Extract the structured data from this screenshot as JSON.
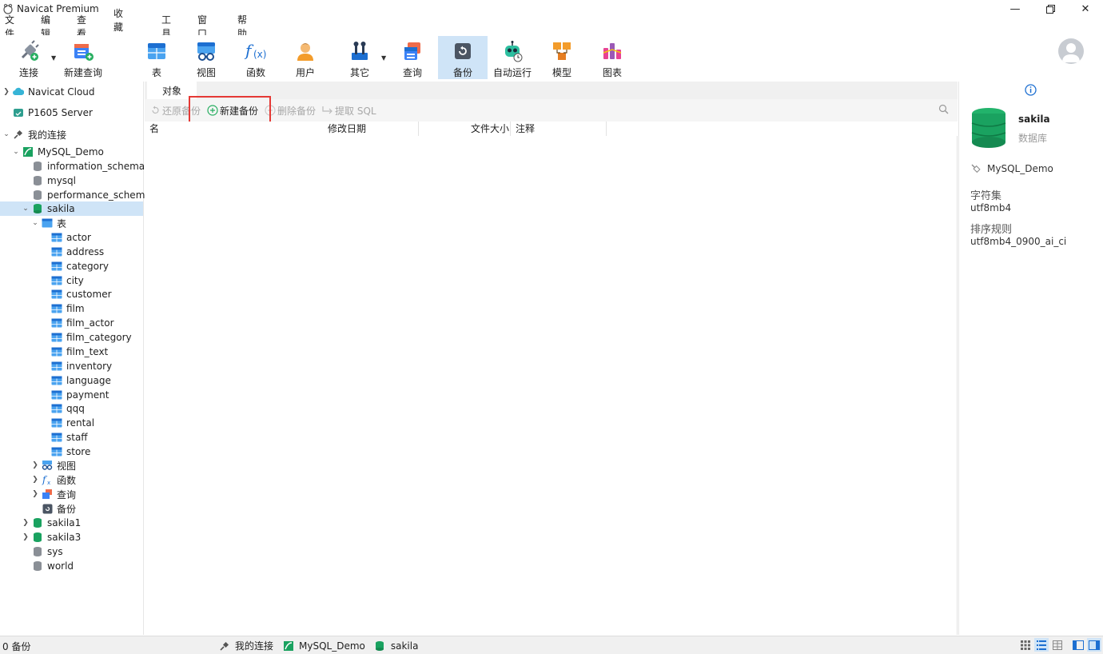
{
  "window": {
    "title": "Navicat Premium"
  },
  "menu": [
    "文件",
    "编辑",
    "查看",
    "收藏夹",
    "工具",
    "窗口",
    "帮助"
  ],
  "toolbar": {
    "connect": "连接",
    "new_query": "新建查询",
    "table": "表",
    "view": "视图",
    "function": "函数",
    "user": "用户",
    "other": "其它",
    "query": "查询",
    "backup": "备份",
    "automation": "自动运行",
    "model": "模型",
    "chart": "图表"
  },
  "nav": {
    "navicat_cloud": "Navicat Cloud",
    "p1605_server": "P1605 Server",
    "my_connections": "我的连接",
    "mysql_demo": "MySQL_Demo",
    "databases_top": [
      "information_schema",
      "mysql",
      "performance_schema"
    ],
    "sakila": "sakila",
    "tables_group": "表",
    "tables": [
      "actor",
      "address",
      "category",
      "city",
      "customer",
      "film",
      "film_actor",
      "film_category",
      "film_text",
      "inventory",
      "language",
      "payment",
      "qqq",
      "rental",
      "staff",
      "store"
    ],
    "views": "视图",
    "functions": "函数",
    "queries": "查询",
    "backups": "备份",
    "databases_bottom": [
      "sakila1",
      "sakila3",
      "sys",
      "world"
    ]
  },
  "main": {
    "tab": "对象",
    "restore_backup": "还原备份",
    "new_backup": "新建备份",
    "delete_backup": "删除备份",
    "extract_sql": "提取 SQL",
    "columns": {
      "name": "名",
      "modified": "修改日期",
      "size": "文件大小",
      "comment": "注释"
    }
  },
  "info": {
    "db_name": "sakila",
    "db_type": "数据库",
    "connection": "MySQL_Demo",
    "charset_label": "字符集",
    "charset": "utf8mb4",
    "collation_label": "排序规则",
    "collation": "utf8mb4_0900_ai_ci"
  },
  "status": {
    "count": "0 备份",
    "crumb_connections": "我的连接",
    "crumb_connection": "MySQL_Demo",
    "crumb_db": "sakila"
  },
  "colors": {
    "selection": "#cfe4f7",
    "db_green": "#1aa260",
    "highlight_red": "#e53935"
  }
}
